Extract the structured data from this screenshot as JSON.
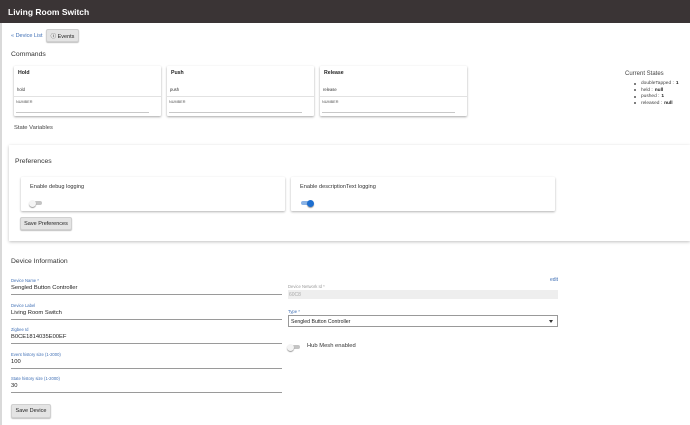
{
  "header": {
    "title": "Living Room Switch"
  },
  "nav": {
    "back_link": "« Device List",
    "events_icon": "info-circle-icon",
    "events_label": "ⓘ Events"
  },
  "commands": {
    "title": "Commands",
    "items": [
      {
        "name": "Hold",
        "value": "hold",
        "placeholder": "NUMBER"
      },
      {
        "name": "Push",
        "value": "push",
        "placeholder": "NUMBER"
      },
      {
        "name": "Release",
        "value": "release",
        "placeholder": "NUMBER"
      }
    ]
  },
  "current_states": {
    "title": "Current States",
    "items": [
      {
        "key": "doubleTapped :",
        "value": "1"
      },
      {
        "key": "held :",
        "value": "null"
      },
      {
        "key": "pushed :",
        "value": "1"
      },
      {
        "key": "released :",
        "value": "null"
      }
    ]
  },
  "state_variables": {
    "title": "State Variables"
  },
  "preferences": {
    "title": "Preferences",
    "debug": {
      "label": "Enable debug logging",
      "enabled": false
    },
    "desc": {
      "label": "Enable descriptionText logging",
      "enabled": true
    },
    "save_label": "Save Preferences"
  },
  "device_info": {
    "title": "Device Information",
    "edit_label": "edit",
    "device_name": {
      "label": "Device Name *",
      "value": "Sengled Button Controller"
    },
    "device_label": {
      "label": "Device Label",
      "value": "Living Room Switch"
    },
    "zigbee_id": {
      "label": "Zigbee Id",
      "value": "B0CE1814035E00EF"
    },
    "event_history": {
      "label": "Event history size (1-2000)",
      "value": "100"
    },
    "state_history": {
      "label": "State history size (1-2000)",
      "value": "30"
    },
    "network_id": {
      "label": "Device Network Id *",
      "value": "60C8"
    },
    "type": {
      "label": "Type *",
      "value": "Sengled Button Controller"
    },
    "hub_mesh": {
      "label": "Hub Mesh enabled",
      "enabled": false
    },
    "save_label": "Save Device"
  },
  "colors": {
    "header_bg": "#3a3435",
    "link": "#3f6fb5",
    "toggle_on": "#1e6fd0"
  }
}
